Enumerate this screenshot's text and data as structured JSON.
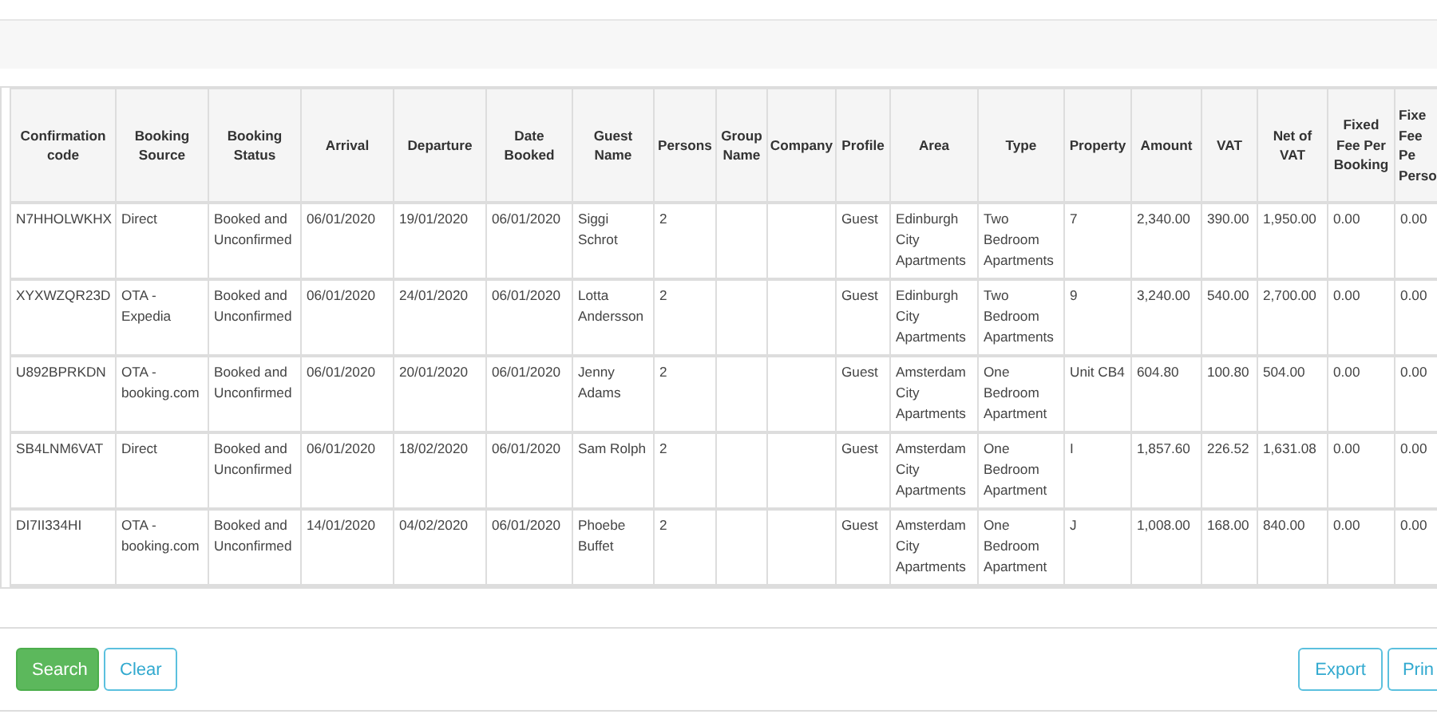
{
  "table": {
    "columns": [
      "Confirmation code",
      "Booking Source",
      "Booking Status",
      "Arrival",
      "Departure",
      "Date Booked",
      "Guest Name",
      "Persons",
      "Group Name",
      "Company",
      "Profile",
      "Area",
      "Type",
      "Property",
      "Amount",
      "VAT",
      "Net of VAT",
      "Fixed Fee Per Booking",
      "Fixe Fee Pe Perso"
    ],
    "rows": [
      [
        "N7HHOLWKHX",
        "Direct",
        "Booked and Unconfirmed",
        "06/01/2020",
        "19/01/2020",
        "06/01/2020",
        "Siggi Schrot",
        "2",
        "",
        "",
        "Guest",
        "Edinburgh City Apartments",
        "Two Bedroom Apartments",
        "7",
        "2,340.00",
        "390.00",
        "1,950.00",
        "0.00",
        "0.00"
      ],
      [
        "XYXWZQR23D",
        "OTA - Expedia",
        "Booked and Unconfirmed",
        "06/01/2020",
        "24/01/2020",
        "06/01/2020",
        "Lotta Andersson",
        "2",
        "",
        "",
        "Guest",
        "Edinburgh City Apartments",
        "Two Bedroom Apartments",
        "9",
        "3,240.00",
        "540.00",
        "2,700.00",
        "0.00",
        "0.00"
      ],
      [
        "U892BPRKDN",
        "OTA - booking.com",
        "Booked and Unconfirmed",
        "06/01/2020",
        "20/01/2020",
        "06/01/2020",
        "Jenny Adams",
        "2",
        "",
        "",
        "Guest",
        "Amsterdam City Apartments",
        "One Bedroom Apartment",
        "Unit CB4",
        "604.80",
        "100.80",
        "504.00",
        "0.00",
        "0.00"
      ],
      [
        "SB4LNM6VAT",
        "Direct",
        "Booked and Unconfirmed",
        "06/01/2020",
        "18/02/2020",
        "06/01/2020",
        "Sam Rolph",
        "2",
        "",
        "",
        "Guest",
        "Amsterdam City Apartments",
        "One Bedroom Apartment",
        "I",
        "1,857.60",
        "226.52",
        "1,631.08",
        "0.00",
        "0.00"
      ],
      [
        "DI7II334HI",
        "OTA - booking.com",
        "Booked and Unconfirmed",
        "14/01/2020",
        "04/02/2020",
        "06/01/2020",
        "Phoebe Buffet",
        "2",
        "",
        "",
        "Guest",
        "Amsterdam City Apartments",
        "One Bedroom Apartment",
        "J",
        "1,008.00",
        "168.00",
        "840.00",
        "0.00",
        "0.00"
      ]
    ]
  },
  "buttons": [
    {
      "label": "Search",
      "kind": "primary"
    },
    {
      "label": "Clear",
      "kind": "outline"
    },
    {
      "label": "Export",
      "kind": "outline"
    },
    {
      "label": "Prin",
      "kind": "outline"
    }
  ]
}
